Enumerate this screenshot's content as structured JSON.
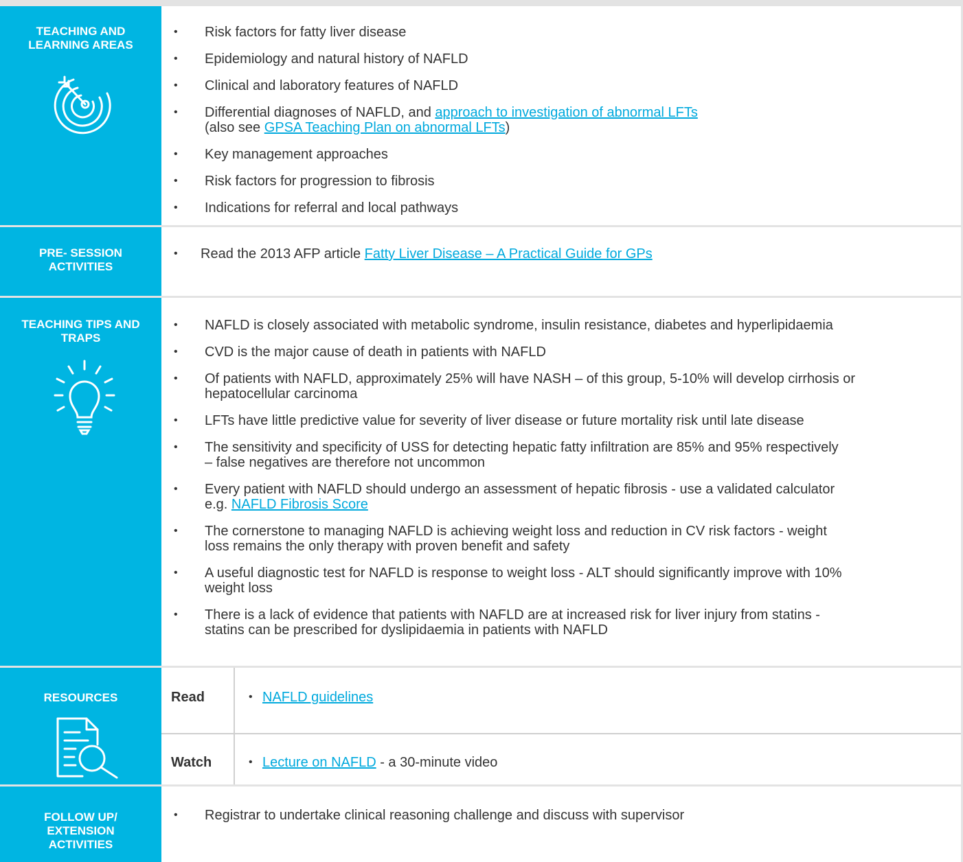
{
  "sections": {
    "teaching_learning": {
      "label": "TEACHING AND LEARNING AREAS",
      "items": [
        {
          "text": "Risk factors for fatty liver disease"
        },
        {
          "text": "Epidemiology and natural history of NAFLD"
        },
        {
          "text": "Clinical and laboratory features of NAFLD"
        },
        {
          "pre": "Differential diagnoses of NAFLD, and ",
          "link": "approach to investigation of abnormal LFTs",
          "pre2": "(also see ",
          "link2": "GPSA Teaching Plan on abnormal LFTs",
          "post2": ")"
        },
        {
          "text": "Key management approaches"
        },
        {
          "text": "Risk factors for progression to fibrosis"
        },
        {
          "text": "Indications for referral and local pathways"
        }
      ]
    },
    "pre_session": {
      "label": "PRE- SESSION ACTIVITIES",
      "pre": "Read the 2013 AFP article ",
      "link": "Fatty Liver Disease – A Practical Guide for GPs"
    },
    "tips_traps": {
      "label": "TEACHING TIPS AND TRAPS",
      "items": [
        {
          "l1": "NAFLD is closely associated with metabolic syndrome, insulin resistance, diabetes and hyperlipidaemia"
        },
        {
          "l1": "CVD is the major cause of death in patients with NAFLD"
        },
        {
          "l1": "Of patients with NAFLD, approximately 25% will have NASH – of this group, 5-10% will develop cirrhosis or",
          "l2": "hepatocellular carcinoma"
        },
        {
          "l1": "LFTs have little predictive value for severity of liver disease or future mortality risk until late disease"
        },
        {
          "l1": "The sensitivity and specificity of USS for detecting hepatic fatty infiltration are 85% and 95% respectively",
          "l2": "– false negatives are therefore not uncommon"
        },
        {
          "l1": "Every patient with NAFLD should undergo an assessment of hepatic fibrosis - use a validated calculator",
          "l2pre": "e.g. ",
          "l2link": "NAFLD Fibrosis Score"
        },
        {
          "l1": "The cornerstone to managing NAFLD is achieving weight loss and reduction in CV risk factors - weight",
          "l2": "loss remains the only therapy with proven benefit and safety"
        },
        {
          "l1": "A useful diagnostic test for NAFLD is response to weight loss - ALT should significantly improve with 10%",
          "l2": "weight loss"
        },
        {
          "l1": "There is a lack of evidence that patients with NAFLD are at increased risk for liver injury from statins -",
          "l2": "statins can be prescribed for dyslipidaemia in patients with NAFLD"
        }
      ]
    },
    "resources": {
      "label": "RESOURCES",
      "read_key": "Read",
      "read_link": "NAFLD guidelines",
      "watch_key": "Watch",
      "watch_link": "Lecture on NAFLD",
      "watch_post": " - a 30-minute video"
    },
    "follow_up": {
      "label": "FOLLOW UP/ EXTENSION ACTIVITIES",
      "item": "Registrar to undertake clinical reasoning challenge and discuss with supervisor"
    }
  },
  "colors": {
    "accent": "#00b5e2",
    "link": "#00a9dd",
    "text": "#333333"
  },
  "icons": [
    "target-icon",
    "lightbulb-icon",
    "document-search-icon"
  ]
}
